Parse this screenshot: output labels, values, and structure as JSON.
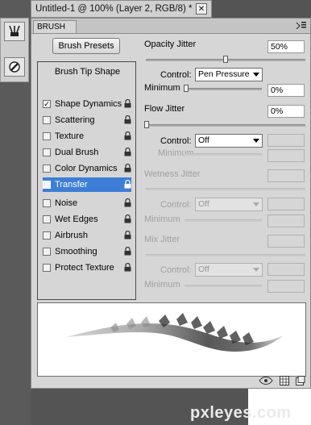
{
  "document_tab": {
    "title": "Untitled-1 @ 100% (Layer 2, RGB/8) *",
    "close": "✕"
  },
  "panel": {
    "tab_label": "BRUSH",
    "menu_icon": "panel-menu-icon",
    "presets_button": "Brush Presets",
    "brush_tip_shape": "Brush Tip Shape",
    "options": [
      {
        "label": "Shape Dynamics",
        "checked": true,
        "selected": false
      },
      {
        "label": "Scattering",
        "checked": false,
        "selected": false
      },
      {
        "label": "Texture",
        "checked": false,
        "selected": false
      },
      {
        "label": "Dual Brush",
        "checked": false,
        "selected": false
      },
      {
        "label": "Color Dynamics",
        "checked": false,
        "selected": false
      },
      {
        "label": "Transfer",
        "checked": true,
        "selected": true
      },
      {
        "label": "Noise",
        "checked": false,
        "selected": false
      },
      {
        "label": "Wet Edges",
        "checked": false,
        "selected": false
      },
      {
        "label": "Airbrush",
        "checked": false,
        "selected": false
      },
      {
        "label": "Smoothing",
        "checked": false,
        "selected": false
      },
      {
        "label": "Protect Texture",
        "checked": false,
        "selected": false
      }
    ],
    "opacity_jitter": {
      "label": "Opacity Jitter",
      "value": "50%",
      "level": 0.5
    },
    "opacity_control": {
      "label": "Control:",
      "value": "Pen Pressure"
    },
    "opacity_minimum": {
      "label": "Minimum",
      "value": "0%",
      "level": 0
    },
    "flow_jitter": {
      "label": "Flow Jitter",
      "value": "0%",
      "level": 0
    },
    "flow_control": {
      "label": "Control:",
      "value": "Off"
    },
    "flow_minimum": {
      "label": "Minimum"
    },
    "wetness_jitter": {
      "label": "Wetness Jitter"
    },
    "wetness_control": {
      "label": "Control:",
      "value": "Off"
    },
    "wetness_minimum": {
      "label": "Minimum"
    },
    "mix_jitter": {
      "label": "Mix Jitter"
    },
    "mix_control": {
      "label": "Control:",
      "value": "Off"
    },
    "mix_minimum": {
      "label": "Minimum"
    },
    "footer_icons": [
      "eye-icon",
      "grid-icon",
      "new-preset-icon"
    ]
  },
  "tool_icons": [
    "brush-icon",
    "brush-presets-icon"
  ],
  "watermark": "pxleyes.com",
  "colors": {
    "selection": "#3d7fd6",
    "panel_bg": "#d6d6d6",
    "workspace": "#545454"
  }
}
